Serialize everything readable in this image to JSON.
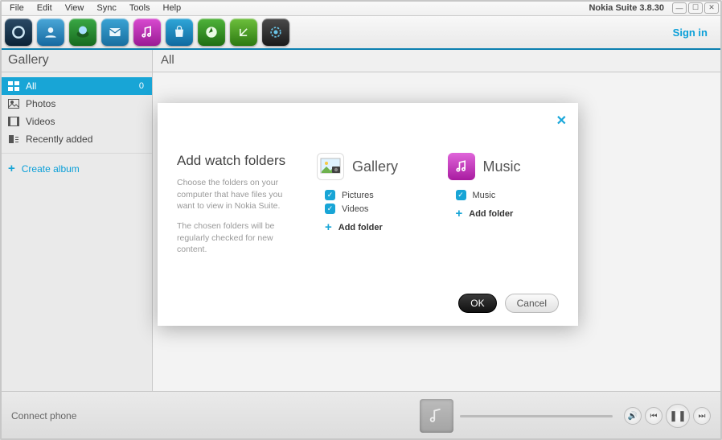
{
  "menubar": {
    "items": [
      "File",
      "Edit",
      "View",
      "Sync",
      "Tools",
      "Help"
    ],
    "app_title": "Nokia Suite 3.8.30"
  },
  "toolbar": {
    "signin": "Sign in"
  },
  "sections": {
    "left_title": "Gallery",
    "right_title": "All"
  },
  "sidebar": {
    "items": [
      {
        "label": "All",
        "count": "0",
        "active": true
      },
      {
        "label": "Photos"
      },
      {
        "label": "Videos"
      },
      {
        "label": "Recently added"
      }
    ],
    "create_album": "Create album"
  },
  "bottombar": {
    "connect": "Connect phone"
  },
  "modal": {
    "title": "Add watch folders",
    "desc1": "Choose the folders on your computer that have files you want to view in Nokia Suite.",
    "desc2": "The chosen folders will be regularly checked for new content.",
    "gallery": {
      "title": "Gallery",
      "opts": [
        "Pictures",
        "Videos"
      ],
      "add": "Add folder"
    },
    "music": {
      "title": "Music",
      "opts": [
        "Music"
      ],
      "add": "Add folder"
    },
    "ok": "OK",
    "cancel": "Cancel"
  }
}
